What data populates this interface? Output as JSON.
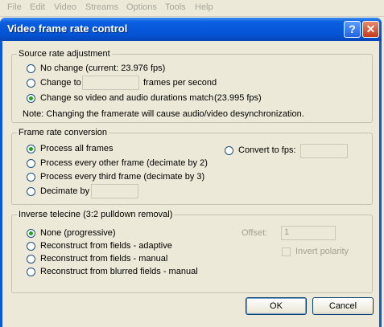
{
  "menubar": {
    "items": [
      "File",
      "Edit",
      "Video",
      "Streams",
      "Options",
      "Tools",
      "Help"
    ]
  },
  "dialog": {
    "title": "Video frame rate control",
    "help_glyph": "?",
    "close_glyph": "✕"
  },
  "source_rate": {
    "legend": "Source rate adjustment",
    "no_change": "No change (current: 23.976 fps)",
    "change_to": "Change to",
    "change_to_value": "",
    "change_to_suffix": "frames per second",
    "match_durations": "Change so video and audio durations match",
    "match_fps": "(23.995 fps)",
    "note": "Note: Changing the framerate will cause audio/video desynchronization.",
    "selected": "match_durations"
  },
  "conversion": {
    "legend": "Frame rate conversion",
    "process_all": "Process all frames",
    "every_other": "Process every other frame (decimate by 2)",
    "every_third": "Process every third frame (decimate by 3)",
    "decimate_by": "Decimate by",
    "decimate_value": "",
    "convert_to": "Convert to fps:",
    "convert_value": "",
    "selected": "process_all"
  },
  "telecine": {
    "legend": "Inverse telecine (3:2 pulldown removal)",
    "none": "None (progressive)",
    "adaptive": "Reconstruct from fields - adaptive",
    "manual": "Reconstruct from fields - manual",
    "blurred": "Reconstruct from blurred fields - manual",
    "offset_label": "Offset:",
    "offset_value": "1",
    "invert_polarity": "Invert polarity",
    "selected": "none"
  },
  "buttons": {
    "ok": "OK",
    "cancel": "Cancel"
  }
}
